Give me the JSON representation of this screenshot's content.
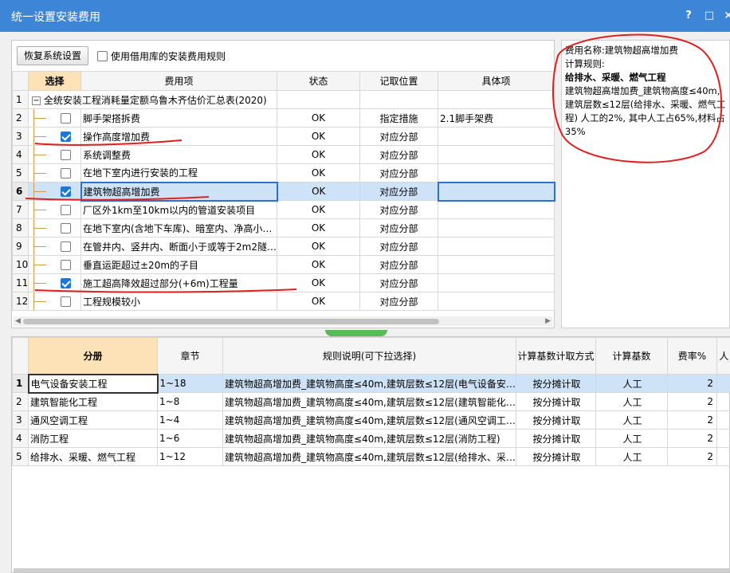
{
  "window": {
    "title": "统一设置安装费用",
    "help_label": "?",
    "maximize_label": "□",
    "close_label": "×"
  },
  "toolbar": {
    "restore_label": "恢复系统设置",
    "use_library_label": "使用借用库的安装费用规则"
  },
  "top_grid": {
    "headers": [
      "",
      "选择",
      "费用项",
      "状态",
      "记取位置",
      "具体项"
    ],
    "rows": [
      {
        "num": "1",
        "item": "全统安装工程消耗量定额乌鲁木齐估价汇总表(2020)",
        "status": "",
        "position": "",
        "detail": "",
        "group": true,
        "checked": false
      },
      {
        "num": "2",
        "item": "脚手架搭拆费",
        "status": "OK",
        "position": "指定措施",
        "detail": "2.1脚手架费",
        "checked": false
      },
      {
        "num": "3",
        "item": "操作高度增加费",
        "status": "OK",
        "position": "对应分部",
        "detail": "",
        "checked": true
      },
      {
        "num": "4",
        "item": "系统调整费",
        "status": "OK",
        "position": "对应分部",
        "detail": "",
        "checked": false
      },
      {
        "num": "5",
        "item": "在地下室内进行安装的工程",
        "status": "OK",
        "position": "对应分部",
        "detail": "",
        "checked": false
      },
      {
        "num": "6",
        "item": "建筑物超高增加费",
        "status": "OK",
        "position": "对应分部",
        "detail": "",
        "checked": true,
        "active": true
      },
      {
        "num": "7",
        "item": "厂区外1km至10km以内的管道安装项目",
        "status": "OK",
        "position": "对应分部",
        "detail": "",
        "checked": false
      },
      {
        "num": "8",
        "item": "在地下室内(含地下车库)、暗室内、净高小…",
        "status": "OK",
        "position": "对应分部",
        "detail": "",
        "checked": false
      },
      {
        "num": "9",
        "item": "在管井内、竖井内、断面小于或等于2m2隧…",
        "status": "OK",
        "position": "对应分部",
        "detail": "",
        "checked": false
      },
      {
        "num": "10",
        "item": "垂直运距超过±20m的子目",
        "status": "OK",
        "position": "对应分部",
        "detail": "",
        "checked": false
      },
      {
        "num": "11",
        "item": "施工超高降效超过部分(+6m)工程量",
        "status": "OK",
        "position": "对应分部",
        "detail": "",
        "checked": true
      },
      {
        "num": "12",
        "item": "工程规模较小",
        "status": "OK",
        "position": "对应分部",
        "detail": "",
        "checked": false
      }
    ]
  },
  "info_panel": {
    "fee_name": "费用名称:建筑物超高增加费",
    "rule_label": "计算规则:",
    "category": "给排水、采暖、燃气工程",
    "desc1": "建筑物超高增加费_建筑物高度≤40m,",
    "desc2": "建筑层数≤12层(给排水、采暖、燃气工",
    "desc3": "程) 人工的2%, 其中人工占65%,材料占",
    "desc4": "35%"
  },
  "bottom_grid": {
    "headers": [
      "",
      "分册",
      "章节",
      "规则说明(可下拉选择)",
      "计算基数计取方式",
      "计算基数",
      "费率%",
      "人"
    ],
    "rows": [
      {
        "num": "1",
        "volume": "电气设备安装工程",
        "chapter": "1~18",
        "rule": "建筑物超高增加费_建筑物高度≤40m,建筑层数≤12层(电气设备安…",
        "method": "按分摊计取",
        "base": "人工",
        "rate": "2",
        "active": true
      },
      {
        "num": "2",
        "volume": "建筑智能化工程",
        "chapter": "1~8",
        "rule": "建筑物超高增加费_建筑物高度≤40m,建筑层数≤12层(建筑智能化…",
        "method": "按分摊计取",
        "base": "人工",
        "rate": "2"
      },
      {
        "num": "3",
        "volume": "通风空调工程",
        "chapter": "1~4",
        "rule": "建筑物超高增加费_建筑物高度≤40m,建筑层数≤12层(通风空调工…",
        "method": "按分摊计取",
        "base": "人工",
        "rate": "2"
      },
      {
        "num": "4",
        "volume": "消防工程",
        "chapter": "1~6",
        "rule": "建筑物超高增加费_建筑物高度≤40m,建筑层数≤12层(消防工程)",
        "method": "按分摊计取",
        "base": "人工",
        "rate": "2"
      },
      {
        "num": "5",
        "volume": "给排水、采暖、燃气工程",
        "chapter": "1~12",
        "rule": "建筑物超高增加费_建筑物高度≤40m,建筑层数≤12层(给排水、采…",
        "method": "按分摊计取",
        "base": "人工",
        "rate": "2"
      }
    ]
  },
  "colors": {
    "titlebar": "#3d85d6",
    "header_highlight": "#fde2b8",
    "active_row": "#cfe3f8",
    "annotation_red": "#e02020",
    "checkbox_on": "#1e77d3"
  }
}
